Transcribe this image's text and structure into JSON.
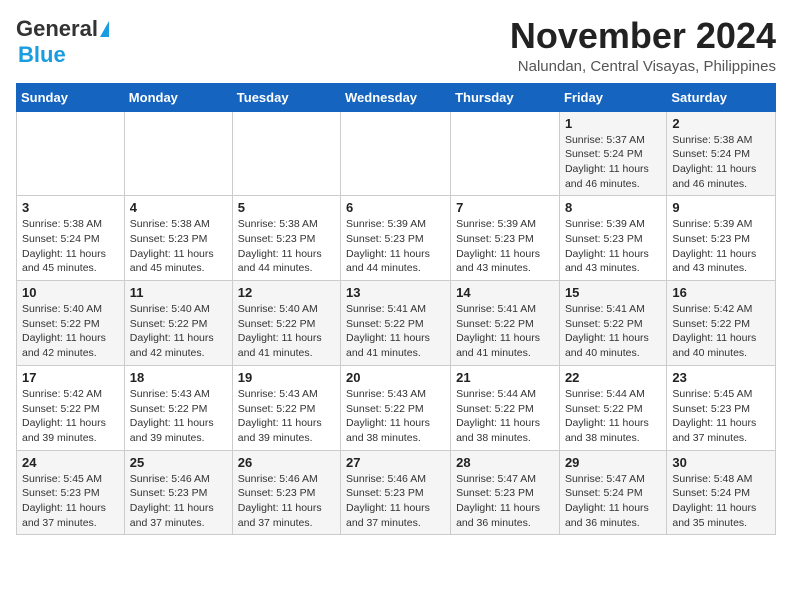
{
  "header": {
    "logo_general": "General",
    "logo_blue": "Blue",
    "month_title": "November 2024",
    "location": "Nalundan, Central Visayas, Philippines"
  },
  "days_of_week": [
    "Sunday",
    "Monday",
    "Tuesday",
    "Wednesday",
    "Thursday",
    "Friday",
    "Saturday"
  ],
  "weeks": [
    [
      {
        "day": "",
        "info": ""
      },
      {
        "day": "",
        "info": ""
      },
      {
        "day": "",
        "info": ""
      },
      {
        "day": "",
        "info": ""
      },
      {
        "day": "",
        "info": ""
      },
      {
        "day": "1",
        "info": "Sunrise: 5:37 AM\nSunset: 5:24 PM\nDaylight: 11 hours and 46 minutes."
      },
      {
        "day": "2",
        "info": "Sunrise: 5:38 AM\nSunset: 5:24 PM\nDaylight: 11 hours and 46 minutes."
      }
    ],
    [
      {
        "day": "3",
        "info": "Sunrise: 5:38 AM\nSunset: 5:24 PM\nDaylight: 11 hours and 45 minutes."
      },
      {
        "day": "4",
        "info": "Sunrise: 5:38 AM\nSunset: 5:23 PM\nDaylight: 11 hours and 45 minutes."
      },
      {
        "day": "5",
        "info": "Sunrise: 5:38 AM\nSunset: 5:23 PM\nDaylight: 11 hours and 44 minutes."
      },
      {
        "day": "6",
        "info": "Sunrise: 5:39 AM\nSunset: 5:23 PM\nDaylight: 11 hours and 44 minutes."
      },
      {
        "day": "7",
        "info": "Sunrise: 5:39 AM\nSunset: 5:23 PM\nDaylight: 11 hours and 43 minutes."
      },
      {
        "day": "8",
        "info": "Sunrise: 5:39 AM\nSunset: 5:23 PM\nDaylight: 11 hours and 43 minutes."
      },
      {
        "day": "9",
        "info": "Sunrise: 5:39 AM\nSunset: 5:23 PM\nDaylight: 11 hours and 43 minutes."
      }
    ],
    [
      {
        "day": "10",
        "info": "Sunrise: 5:40 AM\nSunset: 5:22 PM\nDaylight: 11 hours and 42 minutes."
      },
      {
        "day": "11",
        "info": "Sunrise: 5:40 AM\nSunset: 5:22 PM\nDaylight: 11 hours and 42 minutes."
      },
      {
        "day": "12",
        "info": "Sunrise: 5:40 AM\nSunset: 5:22 PM\nDaylight: 11 hours and 41 minutes."
      },
      {
        "day": "13",
        "info": "Sunrise: 5:41 AM\nSunset: 5:22 PM\nDaylight: 11 hours and 41 minutes."
      },
      {
        "day": "14",
        "info": "Sunrise: 5:41 AM\nSunset: 5:22 PM\nDaylight: 11 hours and 41 minutes."
      },
      {
        "day": "15",
        "info": "Sunrise: 5:41 AM\nSunset: 5:22 PM\nDaylight: 11 hours and 40 minutes."
      },
      {
        "day": "16",
        "info": "Sunrise: 5:42 AM\nSunset: 5:22 PM\nDaylight: 11 hours and 40 minutes."
      }
    ],
    [
      {
        "day": "17",
        "info": "Sunrise: 5:42 AM\nSunset: 5:22 PM\nDaylight: 11 hours and 39 minutes."
      },
      {
        "day": "18",
        "info": "Sunrise: 5:43 AM\nSunset: 5:22 PM\nDaylight: 11 hours and 39 minutes."
      },
      {
        "day": "19",
        "info": "Sunrise: 5:43 AM\nSunset: 5:22 PM\nDaylight: 11 hours and 39 minutes."
      },
      {
        "day": "20",
        "info": "Sunrise: 5:43 AM\nSunset: 5:22 PM\nDaylight: 11 hours and 38 minutes."
      },
      {
        "day": "21",
        "info": "Sunrise: 5:44 AM\nSunset: 5:22 PM\nDaylight: 11 hours and 38 minutes."
      },
      {
        "day": "22",
        "info": "Sunrise: 5:44 AM\nSunset: 5:22 PM\nDaylight: 11 hours and 38 minutes."
      },
      {
        "day": "23",
        "info": "Sunrise: 5:45 AM\nSunset: 5:23 PM\nDaylight: 11 hours and 37 minutes."
      }
    ],
    [
      {
        "day": "24",
        "info": "Sunrise: 5:45 AM\nSunset: 5:23 PM\nDaylight: 11 hours and 37 minutes."
      },
      {
        "day": "25",
        "info": "Sunrise: 5:46 AM\nSunset: 5:23 PM\nDaylight: 11 hours and 37 minutes."
      },
      {
        "day": "26",
        "info": "Sunrise: 5:46 AM\nSunset: 5:23 PM\nDaylight: 11 hours and 37 minutes."
      },
      {
        "day": "27",
        "info": "Sunrise: 5:46 AM\nSunset: 5:23 PM\nDaylight: 11 hours and 37 minutes."
      },
      {
        "day": "28",
        "info": "Sunrise: 5:47 AM\nSunset: 5:23 PM\nDaylight: 11 hours and 36 minutes."
      },
      {
        "day": "29",
        "info": "Sunrise: 5:47 AM\nSunset: 5:24 PM\nDaylight: 11 hours and 36 minutes."
      },
      {
        "day": "30",
        "info": "Sunrise: 5:48 AM\nSunset: 5:24 PM\nDaylight: 11 hours and 35 minutes."
      }
    ]
  ]
}
